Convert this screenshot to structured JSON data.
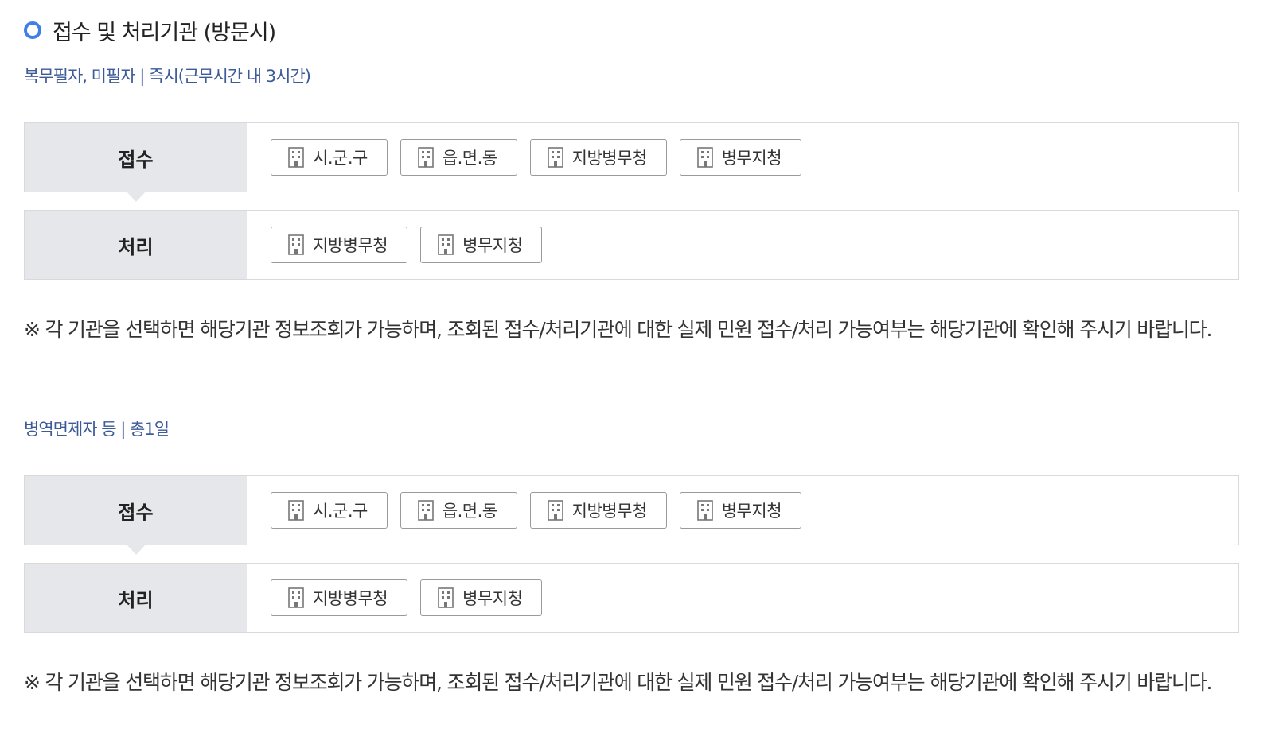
{
  "section": {
    "title": "접수 및 처리기관 (방문시)"
  },
  "groups": [
    {
      "label": "복무필자, 미필자 | 즉시(근무시간 내 3시간)",
      "receive": {
        "label": "접수",
        "orgs": [
          "시.군.구",
          "읍.면.동",
          "지방병무청",
          "병무지청"
        ]
      },
      "process": {
        "label": "처리",
        "orgs": [
          "지방병무청",
          "병무지청"
        ]
      },
      "notice": "※ 각 기관을 선택하면 해당기관 정보조회가 가능하며, 조회된 접수/처리기관에 대한 실제 민원 접수/처리 가능여부는 해당기관에 확인해 주시기 바랍니다."
    },
    {
      "label": "병역면제자 등 | 총1일",
      "receive": {
        "label": "접수",
        "orgs": [
          "시.군.구",
          "읍.면.동",
          "지방병무청",
          "병무지청"
        ]
      },
      "process": {
        "label": "처리",
        "orgs": [
          "지방병무청",
          "병무지청"
        ]
      },
      "notice": "※ 각 기관을 선택하면 해당기관 정보조회가 가능하며, 조회된 접수/처리기관에 대한 실제 민원 접수/처리 가능여부는 해당기관에 확인해 주시기 바랍니다."
    }
  ],
  "icons": {
    "org_button_icon": "building-icon",
    "title_bullet": "circle-bullet-icon"
  },
  "colors": {
    "accent": "#3f80e8",
    "sub_label": "#3d5a99",
    "header_bg": "#e6e7eb"
  }
}
